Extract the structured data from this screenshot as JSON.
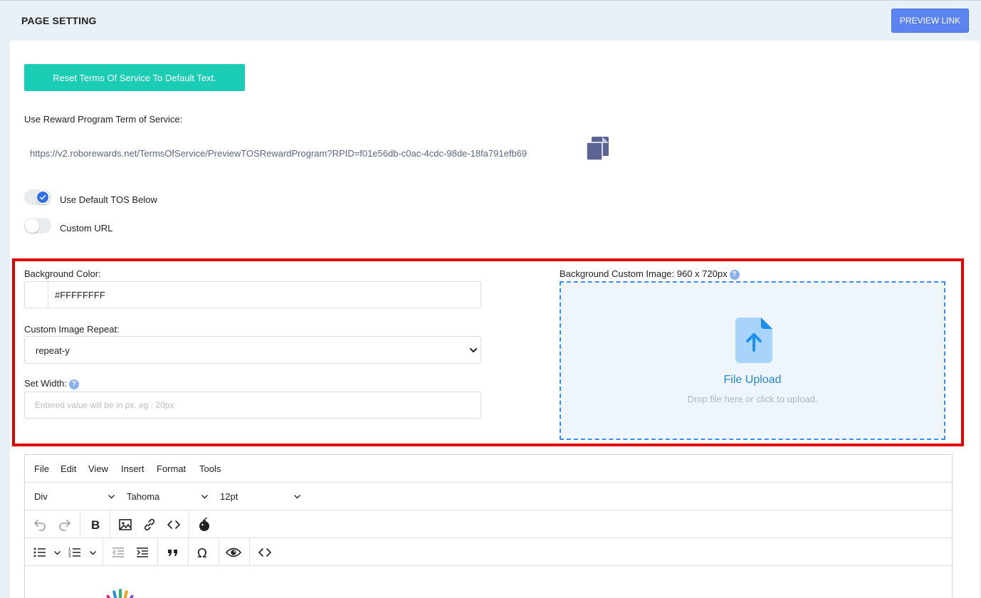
{
  "header": {
    "title": "PAGE SETTING",
    "preview_label": "PREVIEW LINK"
  },
  "tos": {
    "reset_label": "Reset Terms Of Service To Default Text.",
    "use_label": "Use Reward Program Term of Service:",
    "url": "https://v2.roborewards.net/TermsOfService/PreviewTOSRewardProgram?RPID=f01e56db-c0ac-4cdc-98de-18fa791efb69",
    "options": [
      {
        "label": "Use Default TOS Below",
        "checked": true
      },
      {
        "label": "Custom URL",
        "checked": false
      }
    ]
  },
  "background": {
    "color_label": "Background Color:",
    "color_value": "#FFFFFFFF",
    "repeat_label": "Custom Image Repeat:",
    "repeat_value": "repeat-y",
    "width_label": "Set Width:",
    "width_placeholder": "Entered value will be in px. eg : 20px",
    "image_label": "Background Custom Image: 960 x 720px",
    "upload_title": "File Upload",
    "upload_hint": "Drop file here or click to upload."
  },
  "editor": {
    "menu": [
      "File",
      "Edit",
      "View",
      "Insert",
      "Format",
      "Tools"
    ],
    "block_format": "Div",
    "font_family": "Tahoma",
    "font_size": "12pt"
  },
  "colors": {
    "preview_button": "#5c84f0",
    "reset_button": "#1ccdb6",
    "highlight_border": "#e30000",
    "upload_accent": "#3b8de8"
  },
  "icons": {
    "copy": "copy-icon",
    "help": "help-icon",
    "upload": "file-upload-icon",
    "chevron": "chevron-down-icon"
  }
}
